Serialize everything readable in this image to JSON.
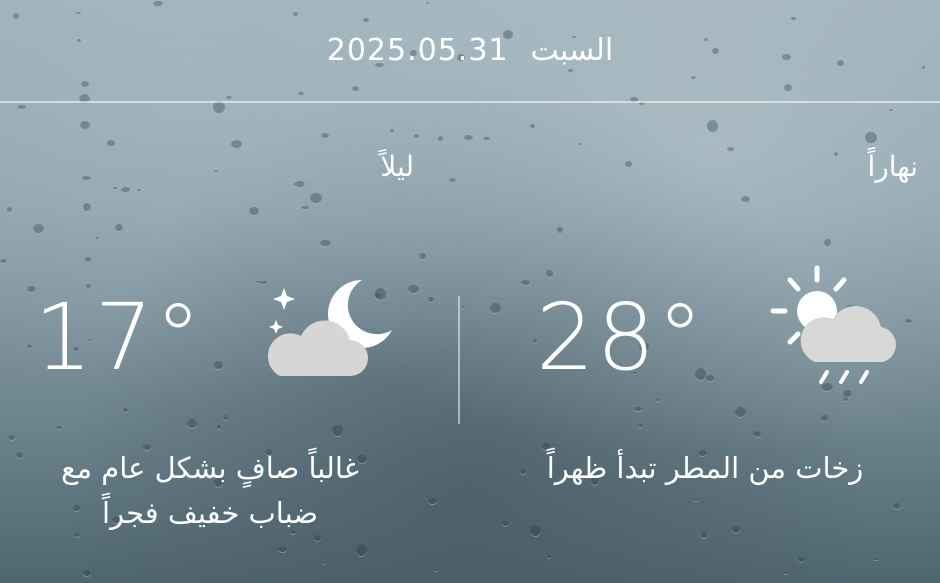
{
  "header": {
    "day_name": "السبت",
    "date": "2025.05.31"
  },
  "day": {
    "label": "نهاراً",
    "temperature": "28°",
    "description": "زخات من المطر تبدأ ظهراً",
    "icon": "sun-cloud-rain-icon"
  },
  "night": {
    "label": "ليلاً",
    "temperature": "17°",
    "description_line1": "غالباً صافٍ بشكل عام مع",
    "description_line2": "ضباب خفيف فجراً",
    "icon": "moon-cloud-icon"
  }
}
